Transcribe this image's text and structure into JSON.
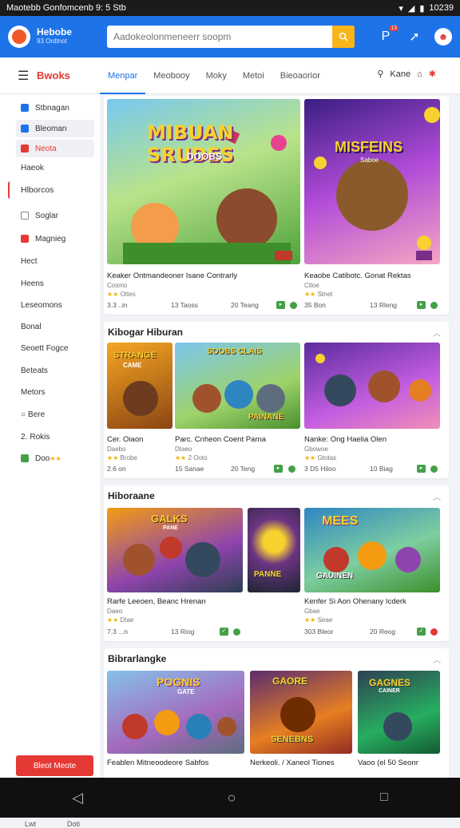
{
  "status": {
    "left": "Maotebb Gonfomcenb 9: 5 Stb",
    "right": "10239"
  },
  "header": {
    "brand": "Hebobe",
    "brand_sub": "93 Ordtnot",
    "search_placeholder": "Aadokeolonmeneerr soopm",
    "badge_count": "13",
    "colors": {
      "brand": "#1e73e8",
      "accent": "#f7b51a",
      "red": "#e53935"
    }
  },
  "topnav": {
    "title": "Bwoks",
    "tabs": [
      "Menpar",
      "Meobooy",
      "Moky",
      "Metoi",
      "Bieoaorior"
    ],
    "right_label": "Kane"
  },
  "sidebar": {
    "items": [
      "Stbnagan",
      "Bleoman",
      "Neota",
      "Haeok",
      "Hlborcos",
      "Soglar",
      "Magnieg",
      "Hect",
      "Heens",
      "Leseomons",
      "Bonal",
      "Seoett Fogce",
      "Beteats",
      "Metors",
      "Bere",
      "Rokis",
      "Doo"
    ],
    "button": "Bleot Meote",
    "icon_labels": [
      "Lwt",
      "Doti"
    ]
  },
  "sections": [
    {
      "title": "",
      "cards": [
        {
          "title": "Keaker Ontmandeoner Isane Contrarly",
          "sub": "Cosmo",
          "rating": "Ottes",
          "meta_left": "3.3 ..in",
          "meta_mid": "13 Taoss",
          "meta_right": "20 Teang",
          "art_title": "MIBUAN SRUDES",
          "art_sub": "DOOBS"
        },
        {
          "title": "Keaobe Catibotc. Gonat Rektas",
          "sub": "Ctloe",
          "rating": "Stnet",
          "meta_left": "35 Bon",
          "meta_mid": "",
          "meta_right": "13 Rleng",
          "art_title": "MISFEINS",
          "art_sub": "Saboe"
        }
      ]
    },
    {
      "title": "Kibogar Hiburan",
      "cards": [
        {
          "title": "Cer. Oiaon",
          "sub": "Daebo",
          "rating": "Brobe",
          "meta_left": "2.6 on",
          "art_title": "STRANGE",
          "art_sub": "CAME"
        },
        {
          "title": "Parc. Cnheon Coent Parna",
          "sub": "Dtaeo",
          "rating": "2 Ooto",
          "meta_left": "",
          "meta_mid": "15 Sanae",
          "meta_right": "20 Teng",
          "art_title": "SOOBS CLAIS",
          "art_sub": "PAINANE"
        },
        {
          "title": "Nanke: Ong Haelia Olen",
          "sub": "Gbowoe",
          "rating": "Gtotas",
          "meta_left": "3 D5 Hiloo",
          "meta_right": "10 Biag"
        }
      ]
    },
    {
      "title": "Hiboraane",
      "cards": [
        {
          "title": "Rarfe Leeoen, Beanc Hrenan",
          "sub": "Daeo",
          "rating": "Dtae",
          "meta_left": "7.3 ...n",
          "meta_mid": "13 Riog",
          "art_title": "GALKS",
          "art_sub": "PANE"
        },
        {
          "title": "",
          "art_title": "PANNE"
        },
        {
          "title": "Kenfer Si Aon Ohenany Icderk",
          "sub": "Gbae",
          "rating": "Seae",
          "meta_left": "303 Bleor",
          "meta_right": "20 Reog",
          "art_title": "MEES",
          "art_sub": "GAUINEN"
        }
      ]
    },
    {
      "title": "Bibrarlangke",
      "cards": [
        {
          "title": "Feablen Mitneoodeore Sabfos",
          "art_title": "POGNIS",
          "art_sub": "GATE"
        },
        {
          "title": "Nerkeoli. / Xaneol Tiones",
          "art_title": "GAORE",
          "art_sub": "SENEBNS"
        },
        {
          "title": "Vaoo (el 50 Seonr",
          "art_title": "GAGNES",
          "art_sub": "CAINER"
        }
      ]
    }
  ]
}
